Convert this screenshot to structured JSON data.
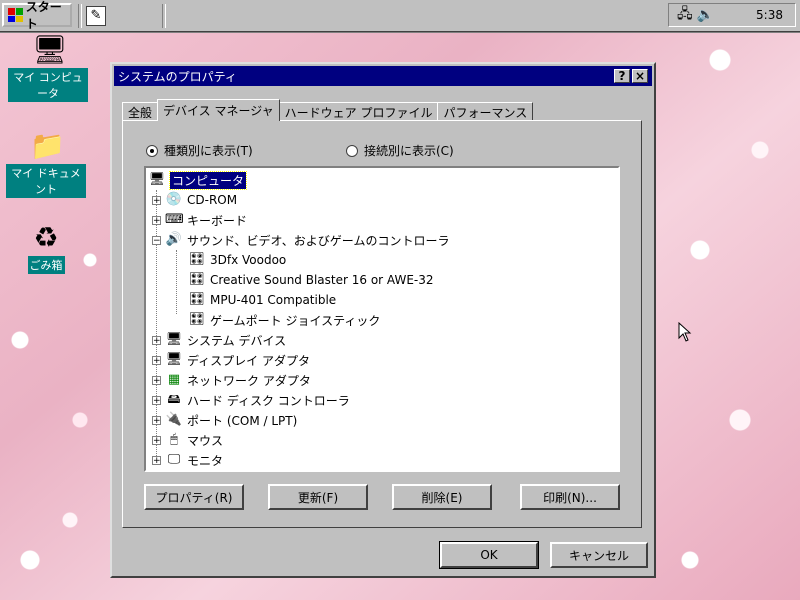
{
  "taskbar": {
    "start_label": "スタート",
    "clock": "5:38",
    "quicklaunch_icon": "notepad-icon",
    "tray_icons": [
      "network-icon",
      "volume-icon"
    ]
  },
  "desktop": {
    "icons": [
      {
        "label": "マイ コンピュータ",
        "icon": "my-computer-icon"
      },
      {
        "label": "マイ ドキュメント",
        "icon": "my-documents-icon"
      },
      {
        "label": "ごみ箱",
        "icon": "recycle-bin-icon"
      }
    ]
  },
  "dialog": {
    "title": "システムのプロパティ",
    "help_label": "?",
    "close_label": "×",
    "tabs": [
      {
        "label": "全般"
      },
      {
        "label": "デバイス マネージャ"
      },
      {
        "label": "ハードウェア プロファイル"
      },
      {
        "label": "パフォーマンス"
      }
    ],
    "radio_by_type": "種類別に表示(T)",
    "radio_by_connection": "接続別に表示(C)",
    "tree": {
      "root": "コンピュータ",
      "items": [
        {
          "label": "CD-ROM",
          "expander": "+"
        },
        {
          "label": "キーボード",
          "expander": "+"
        },
        {
          "label": "サウンド、ビデオ、およびゲームのコントローラ",
          "expander": "−"
        },
        {
          "label": "3Dfx Voodoo",
          "child": true
        },
        {
          "label": "Creative Sound Blaster 16 or AWE-32",
          "child": true
        },
        {
          "label": "MPU-401 Compatible",
          "child": true
        },
        {
          "label": "ゲームポート ジョイスティック",
          "child": true
        },
        {
          "label": "システム デバイス",
          "expander": "+"
        },
        {
          "label": "ディスプレイ アダプタ",
          "expander": "+"
        },
        {
          "label": "ネットワーク アダプタ",
          "expander": "+"
        },
        {
          "label": "ハード ディスク コントローラ",
          "expander": "+"
        },
        {
          "label": "ポート (COM / LPT)",
          "expander": "+"
        },
        {
          "label": "マウス",
          "expander": "+"
        },
        {
          "label": "モニタ",
          "expander": "+"
        }
      ]
    },
    "buttons": {
      "properties": "プロパティ(R)",
      "refresh": "更新(F)",
      "remove": "削除(E)",
      "print": "印刷(N)...",
      "ok": "OK",
      "cancel": "キャンセル"
    }
  }
}
